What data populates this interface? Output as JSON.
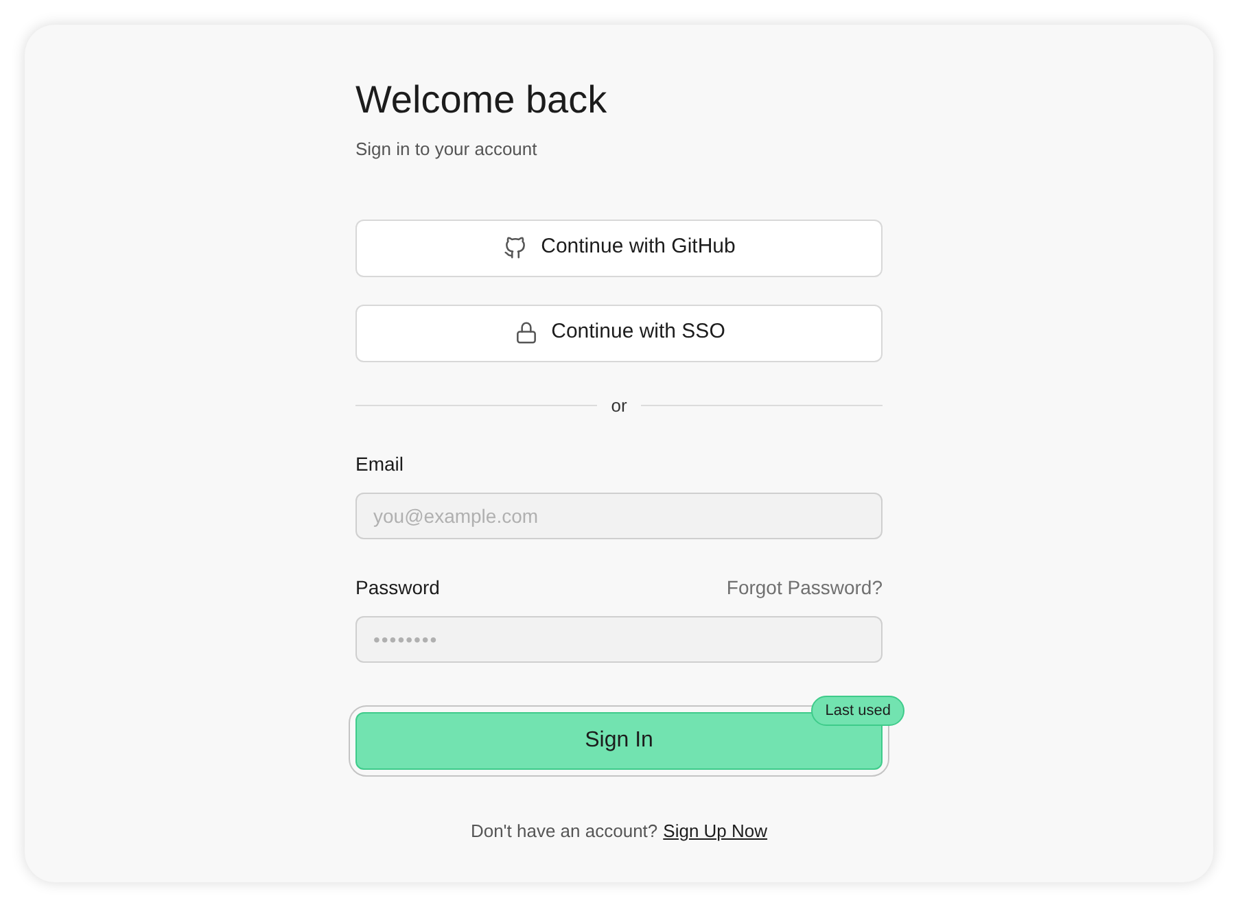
{
  "title": "Welcome back",
  "subtitle": "Sign in to your account",
  "providers": [
    {
      "kind": "github",
      "label": "Continue with GitHub"
    },
    {
      "kind": "sso",
      "label": "Continue with SSO"
    }
  ],
  "divider": "or",
  "fields": [
    {
      "label": "Email",
      "placeholder": "you@example.com",
      "kind": "email"
    },
    {
      "label": "Password",
      "placeholder": "••••••••",
      "kind": "password",
      "link": "Forgot Password?"
    }
  ],
  "submit": {
    "label": "Sign In",
    "badge": "Last used",
    "focused": true
  },
  "footer": {
    "text": "Don't have an account?",
    "link": "Sign Up Now"
  }
}
